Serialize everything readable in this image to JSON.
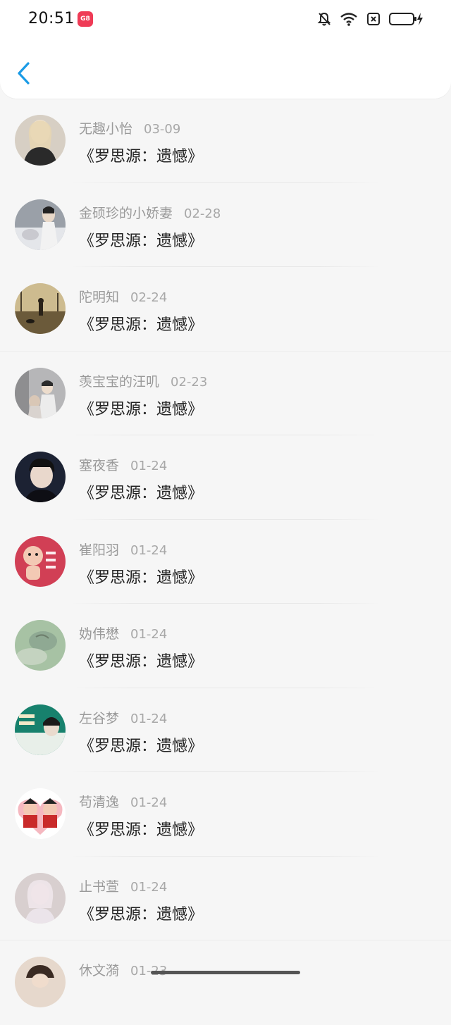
{
  "status_bar": {
    "time": "20:51",
    "app_badge": "G8"
  },
  "colors": {
    "accent": "#1a9be6",
    "list_bg": "#f6f6f6",
    "header_bg": "#ffffff"
  },
  "header": {
    "back_icon": "chevron-left-icon"
  },
  "items": [
    {
      "user": "无趣小怡",
      "date": "03-09",
      "title": "《罗思源：遗憾》"
    },
    {
      "user": "金硕珍的小娇妻",
      "date": "02-28",
      "title": "《罗思源：遗憾》"
    },
    {
      "user": "陀明知",
      "date": "02-24",
      "title": "《罗思源：遗憾》"
    },
    {
      "user": "羡宝宝的汪叽",
      "date": "02-23",
      "title": "《罗思源：遗憾》"
    },
    {
      "user": "塞夜香",
      "date": "01-24",
      "title": "《罗思源：遗憾》"
    },
    {
      "user": "崔阳羽",
      "date": "01-24",
      "title": "《罗思源：遗憾》"
    },
    {
      "user": "妫伟懋",
      "date": "01-24",
      "title": "《罗思源：遗憾》"
    },
    {
      "user": "左谷梦",
      "date": "01-24",
      "title": "《罗思源：遗憾》"
    },
    {
      "user": "苟清逸",
      "date": "01-24",
      "title": "《罗思源：遗憾》"
    },
    {
      "user": "止书萱",
      "date": "01-24",
      "title": "《罗思源：遗憾》"
    },
    {
      "user": "休文漪",
      "date": "01-23",
      "title": ""
    }
  ]
}
